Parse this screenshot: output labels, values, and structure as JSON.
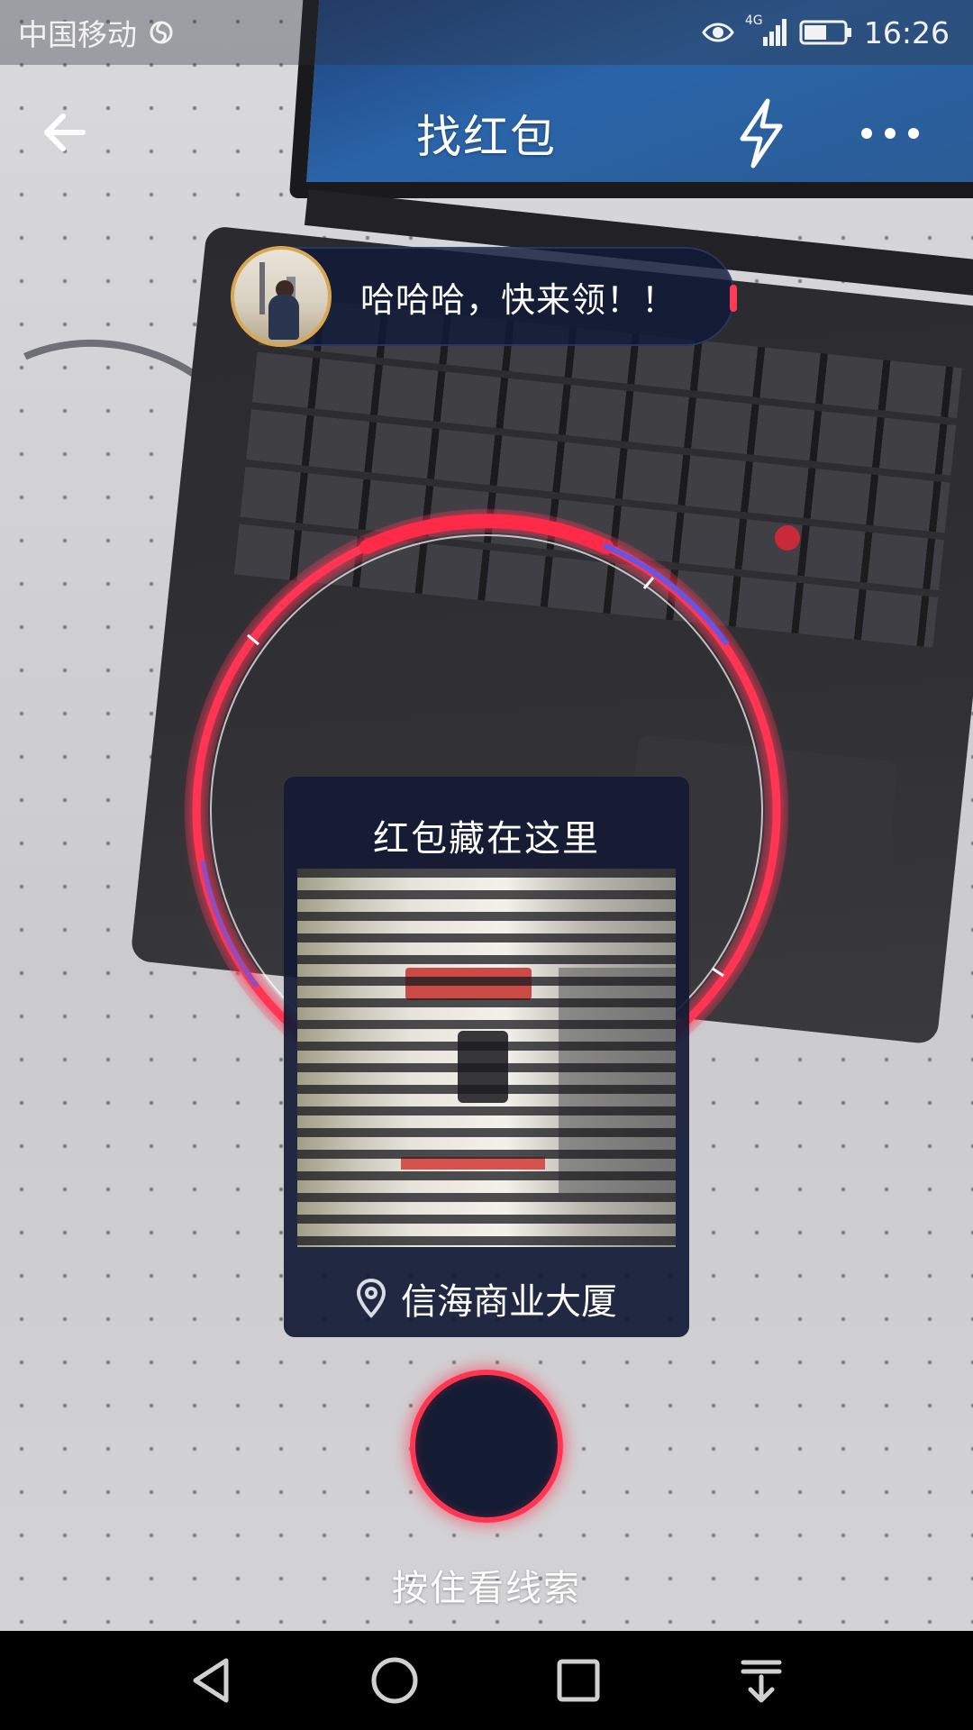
{
  "status_bar": {
    "carrier": "中国移动",
    "network": "4G",
    "time": "16:26",
    "icons": [
      "hotspot-icon",
      "eye-icon",
      "signal-icon",
      "battery-icon"
    ]
  },
  "header": {
    "title": "找红包",
    "icons": [
      "back-arrow-icon",
      "flash-icon",
      "more-icon"
    ]
  },
  "message": {
    "text": "哈哈哈，快来领！！"
  },
  "hint_card": {
    "title": "红包藏在这里",
    "location": "信海商业大厦",
    "location_icon": "location-pin-icon"
  },
  "hold_button": {
    "label": "按住看线索"
  },
  "nav_bar": {
    "icons": [
      "back-triangle-icon",
      "home-circle-icon",
      "recents-square-icon",
      "notification-pull-icon"
    ]
  },
  "colors": {
    "accent_red": "#ff3552",
    "ring_blue": "#4c5cff",
    "card_bg": "#121a34"
  }
}
